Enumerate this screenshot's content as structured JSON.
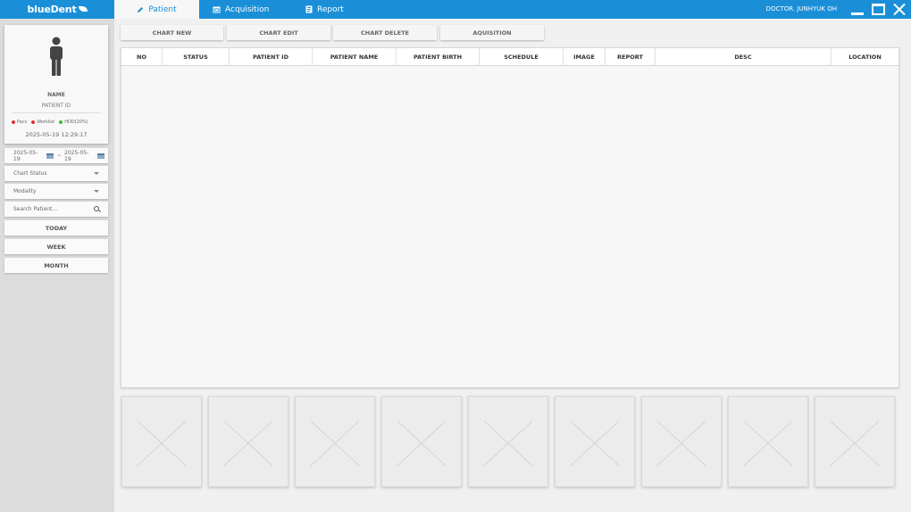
{
  "app": {
    "logo": "blueDent"
  },
  "tabs": [
    {
      "label": "Patient",
      "icon": "pencil-icon",
      "active": true
    },
    {
      "label": "Acquisition",
      "icon": "acquisition-icon",
      "active": false
    },
    {
      "label": "Report",
      "icon": "report-icon",
      "active": false
    }
  ],
  "user": {
    "name": "DOCTOR. JUNHYUK OH"
  },
  "patient_card": {
    "name_label": "NAME",
    "id_label": "PATIENT ID",
    "status": [
      {
        "label": "Pacs",
        "color": "#e03030"
      },
      {
        "label": "Worklist",
        "color": "#e03030"
      },
      {
        "label": "HDD(20%)",
        "color": "#30c030"
      }
    ],
    "datetime": "2025-05-19 12:29:17"
  },
  "filters": {
    "date_from": "2025-05-19",
    "date_sep": "~",
    "date_to": "2025-05-19",
    "chart_status": "Chart Status",
    "modality": "Modality",
    "search_placeholder": "Search Patient...",
    "today": "TODAY",
    "week": "WEEK",
    "month": "MONTH"
  },
  "actions": {
    "chart_new": "CHART NEW",
    "chart_edit": "CHART EDIT",
    "chart_delete": "CHART DELETE",
    "acquisition": "AQUISITION"
  },
  "table": {
    "columns": [
      "NO",
      "STATUS",
      "PATIENT ID",
      "PATIENT NAME",
      "PATIENT BIRTH",
      "SCHEDULE",
      "IMAGE",
      "REPORT",
      "DESC",
      "LOCATION"
    ],
    "rows": []
  },
  "thumbnails": {
    "count": 9
  },
  "colors": {
    "accent": "#1a8fd8",
    "status_error": "#e03030",
    "status_ok": "#30c030"
  }
}
